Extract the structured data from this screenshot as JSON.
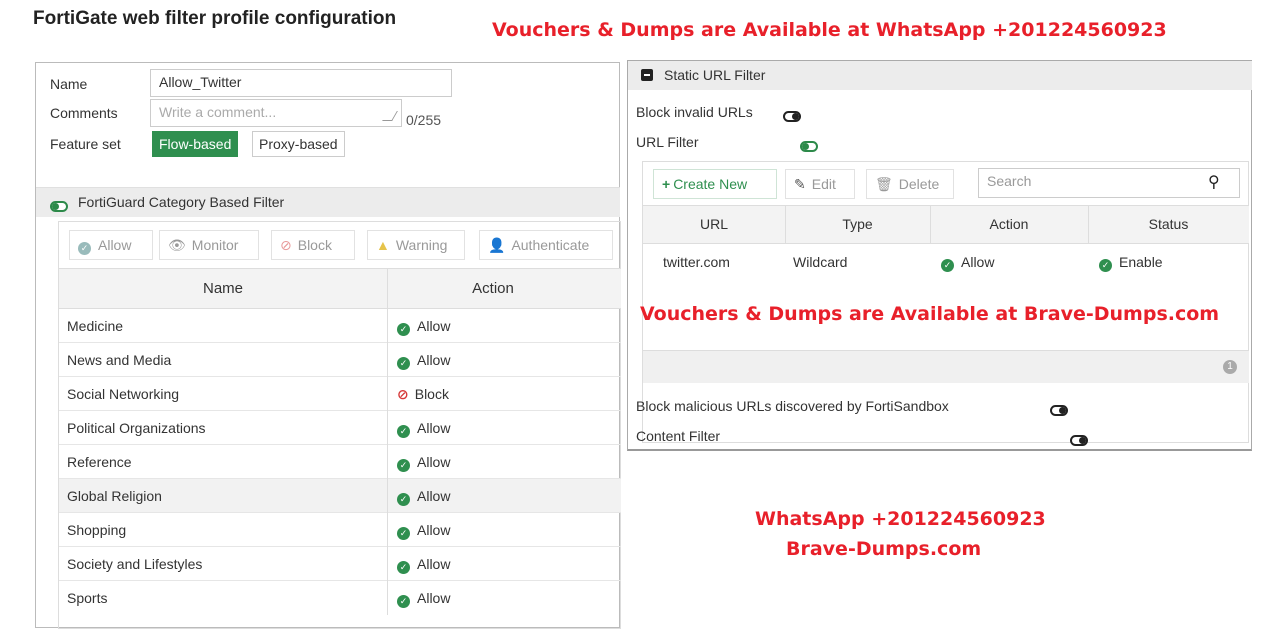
{
  "page": {
    "title": "FortiGate web filter profile configuration"
  },
  "watermarks": {
    "top": "Vouchers & Dumps are Available at WhatsApp +201224560923",
    "middle": "Vouchers & Dumps are Available at Brave-Dumps.com",
    "bottom_line1": "WhatsApp +201224560923",
    "bottom_line2": "Brave-Dumps.com"
  },
  "profile": {
    "name_label": "Name",
    "name_value": "Allow_Twitter",
    "comments_label": "Comments",
    "comments_placeholder": "Write a comment...",
    "comments_counter": "0/255",
    "feature_set_label": "Feature set",
    "feature_set_options": [
      "Flow-based",
      "Proxy-based"
    ],
    "feature_set_selected": "Flow-based"
  },
  "fortiguard": {
    "title": "FortiGuard Category Based Filter",
    "enabled": true,
    "toolbar": [
      "Allow",
      "Monitor",
      "Block",
      "Warning",
      "Authenticate"
    ],
    "columns": [
      "Name",
      "Action"
    ],
    "rows": [
      {
        "name": "Medicine",
        "action": "Allow"
      },
      {
        "name": "News and Media",
        "action": "Allow"
      },
      {
        "name": "Social Networking",
        "action": "Block"
      },
      {
        "name": "Political Organizations",
        "action": "Allow"
      },
      {
        "name": "Reference",
        "action": "Allow"
      },
      {
        "name": "Global Religion",
        "action": "Allow"
      },
      {
        "name": "Shopping",
        "action": "Allow"
      },
      {
        "name": "Society and Lifestyles",
        "action": "Allow"
      },
      {
        "name": "Sports",
        "action": "Allow"
      }
    ]
  },
  "static_url": {
    "title": "Static URL Filter",
    "block_invalid_label": "Block invalid URLs",
    "block_invalid_enabled": false,
    "url_filter_label": "URL Filter",
    "url_filter_enabled": true,
    "toolbar": {
      "create": "Create New",
      "edit": "Edit",
      "delete": "Delete",
      "search_placeholder": "Search"
    },
    "columns": [
      "URL",
      "Type",
      "Action",
      "Status"
    ],
    "rows": [
      {
        "url": "twitter.com",
        "type": "Wildcard",
        "action": "Allow",
        "status": "Enable"
      }
    ],
    "footer_count": "1",
    "block_malicious_label": "Block malicious URLs discovered by FortiSandbox",
    "block_malicious_enabled": false,
    "content_filter_label": "Content Filter",
    "content_filter_enabled": false
  },
  "colors": {
    "accent_green": "#2f8f4f",
    "block_red": "#d63a3a",
    "watermark_red": "#e8202a"
  }
}
